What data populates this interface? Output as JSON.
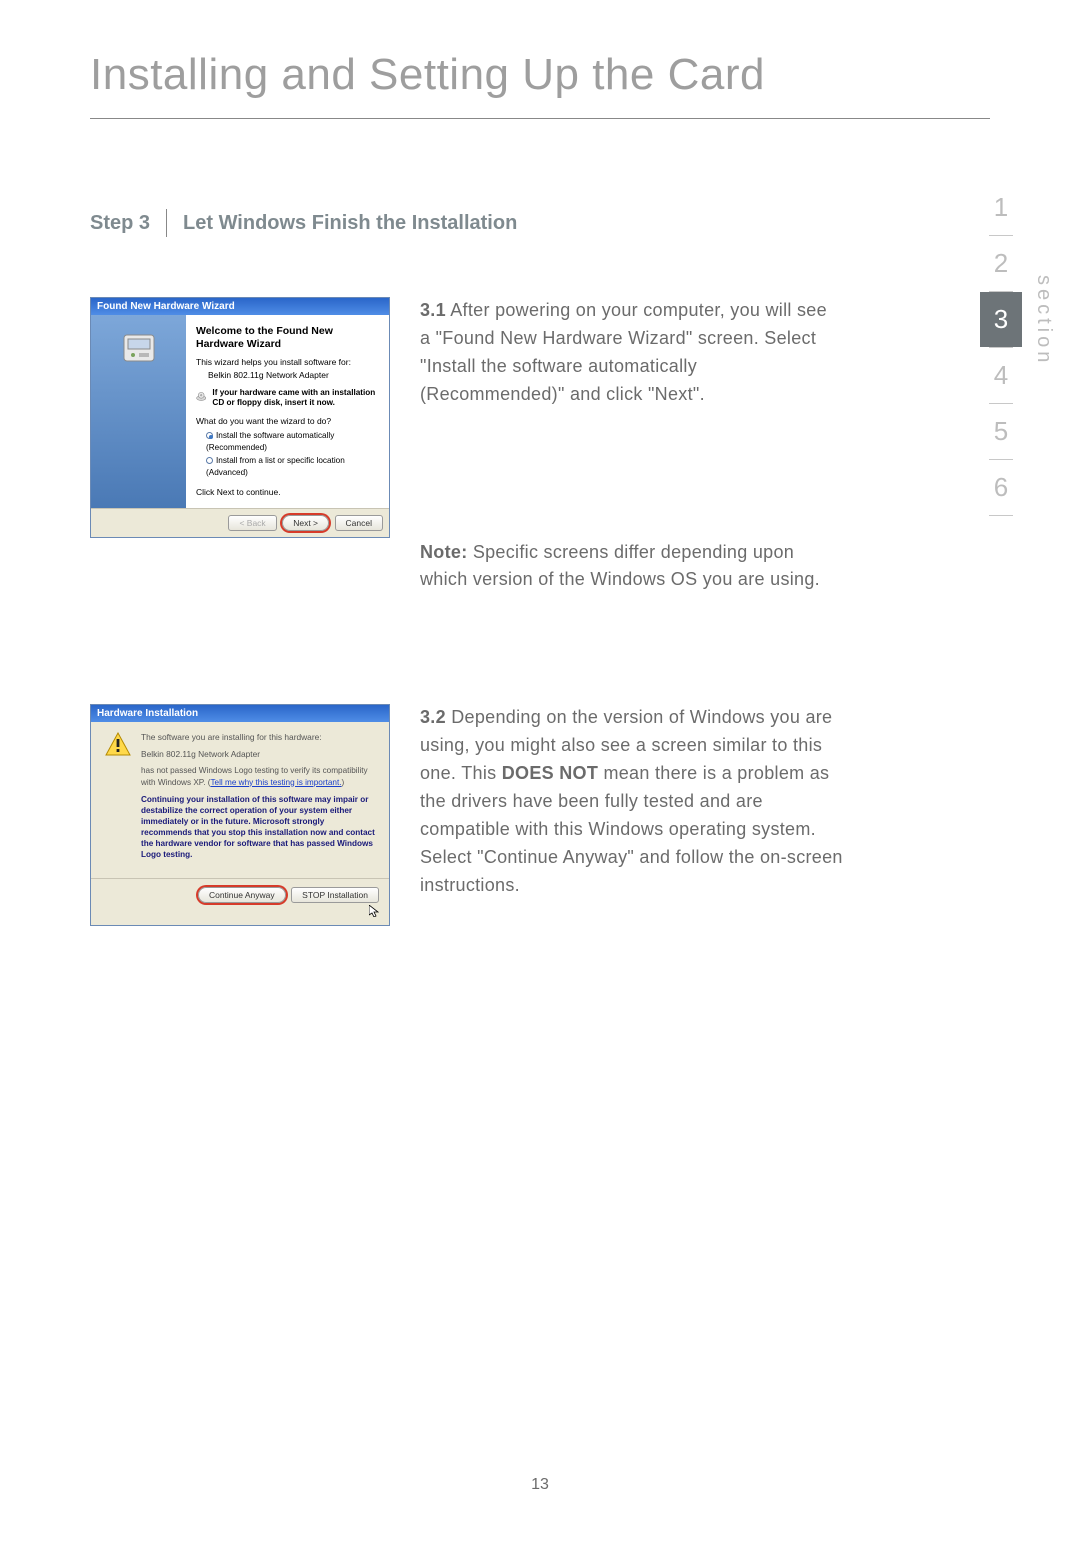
{
  "title": "Installing and Setting Up the Card",
  "step": {
    "label": "Step 3",
    "title": "Let Windows Finish the Installation"
  },
  "p31": {
    "num": "3.1",
    "text": "After powering on your computer, you will see a \"Found New Hardware Wizard\" screen. Select \"Install the software automatically (Recommended)\" and click \"Next\"."
  },
  "note": {
    "label": "Note:",
    "text": "Specific screens differ depending upon which version of the Windows OS you are using."
  },
  "p32": {
    "num": "3.2",
    "t1": "Depending on the version of Windows you are using, you might also see a screen similar to this one. This ",
    "bold": "DOES NOT",
    "t2": " mean there is a problem as the drivers have been fully tested and are compatible with this Windows operating system. Select \"Continue Anyway\" and follow the on-screen instructions."
  },
  "wizard": {
    "title": "Found New Hardware Wizard",
    "heading": "Welcome to the Found New Hardware Wizard",
    "intro": "This wizard helps you install software for:",
    "device": "Belkin 802.11g Network Adapter",
    "cd_hint": "If your hardware came with an installation CD or floppy disk, insert it now.",
    "question": "What do you want the wizard to do?",
    "opt1": "Install the software automatically (Recommended)",
    "opt2": "Install from a list or specific location (Advanced)",
    "cont": "Click Next to continue.",
    "btn_back": "< Back",
    "btn_next": "Next >",
    "btn_cancel": "Cancel"
  },
  "hwwarn": {
    "title": "Hardware Installation",
    "line1": "The software you are installing for this hardware:",
    "device": "Belkin 802.11g Network Adapter",
    "line2a": "has not passed Windows Logo testing to verify its compatibility with Windows XP. (",
    "link": "Tell me why this testing is important.",
    "line2b": ")",
    "bold": "Continuing your installation of this software may impair or destabilize the correct operation of your system either immediately or in the future. Microsoft strongly recommends that you stop this installation now and contact the hardware vendor for software that has passed Windows Logo testing.",
    "btn_continue": "Continue Anyway",
    "btn_stop": "STOP Installation"
  },
  "side": {
    "label": "section",
    "items": [
      "1",
      "2",
      "3",
      "4",
      "5",
      "6"
    ],
    "active_index": 2
  },
  "page_number": "13"
}
